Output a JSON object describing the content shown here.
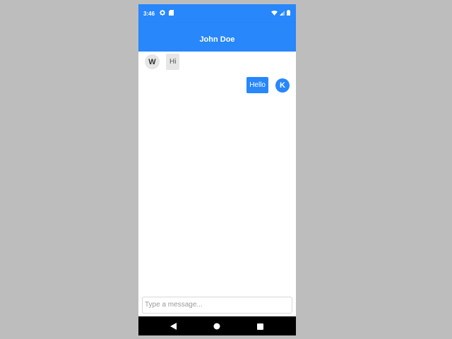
{
  "status_bar": {
    "time": "3:46",
    "left_icons": [
      "gear-icon",
      "sd-card-icon"
    ],
    "right_icons": [
      "wifi-icon",
      "signal-icon",
      "battery-icon"
    ],
    "color": "#2787fb"
  },
  "header": {
    "title": "John Doe"
  },
  "messages": [
    {
      "direction": "incoming",
      "avatar_initial": "W",
      "text": "Hi"
    },
    {
      "direction": "outgoing",
      "avatar_initial": "K",
      "text": "Hello"
    }
  ],
  "composer": {
    "placeholder": "Type a message...",
    "value": ""
  },
  "nav_bar": {
    "buttons": [
      "back-icon",
      "home-icon",
      "recent-apps-icon"
    ]
  },
  "colors": {
    "accent": "#2787fb",
    "incoming_bubble": "#e6e6e6",
    "background": "#bdbdbd"
  }
}
